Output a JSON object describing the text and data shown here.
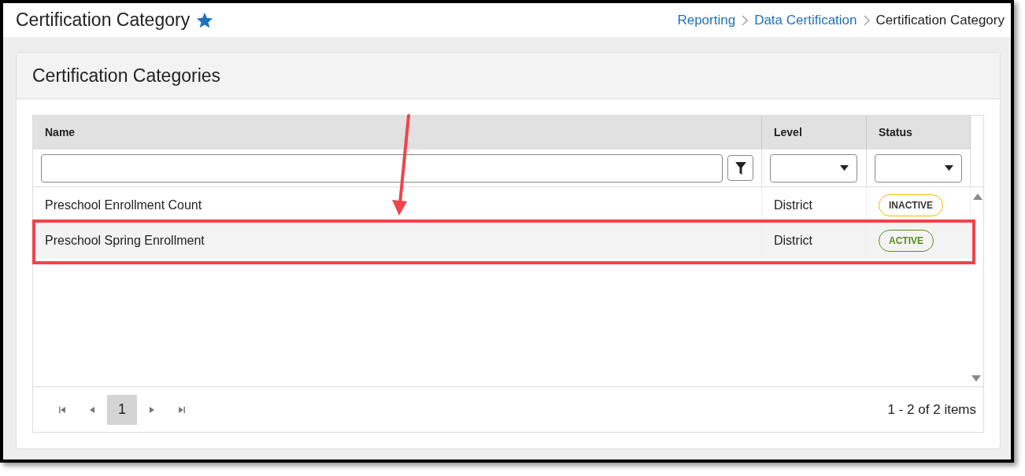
{
  "page": {
    "title": "Certification Category",
    "favorite": true
  },
  "breadcrumb": [
    {
      "label": "Reporting",
      "kind": "link"
    },
    {
      "label": "Data Certification",
      "kind": "link"
    },
    {
      "label": "Certification Category",
      "kind": "current"
    }
  ],
  "panel": {
    "title": "Certification Categories"
  },
  "table": {
    "columns": [
      {
        "label": "Name",
        "kind": "text"
      },
      {
        "label": "Level",
        "kind": "select"
      },
      {
        "label": "Status",
        "kind": "select"
      }
    ],
    "rows": [
      {
        "name": "Preschool Enrollment Count",
        "level": "District",
        "status": "INACTIVE",
        "color": "#f5b800",
        "selected": false
      },
      {
        "name": "Preschool Spring Enrollment",
        "level": "District",
        "status": "ACTIVE",
        "color": "#5b8a1f",
        "selected": true
      }
    ]
  },
  "pager": {
    "pages": [
      {
        "label": "1",
        "selected": true
      }
    ],
    "summary": "1 - 2 of 2 items"
  },
  "annotations": {
    "arrow": true,
    "highlight": true
  }
}
